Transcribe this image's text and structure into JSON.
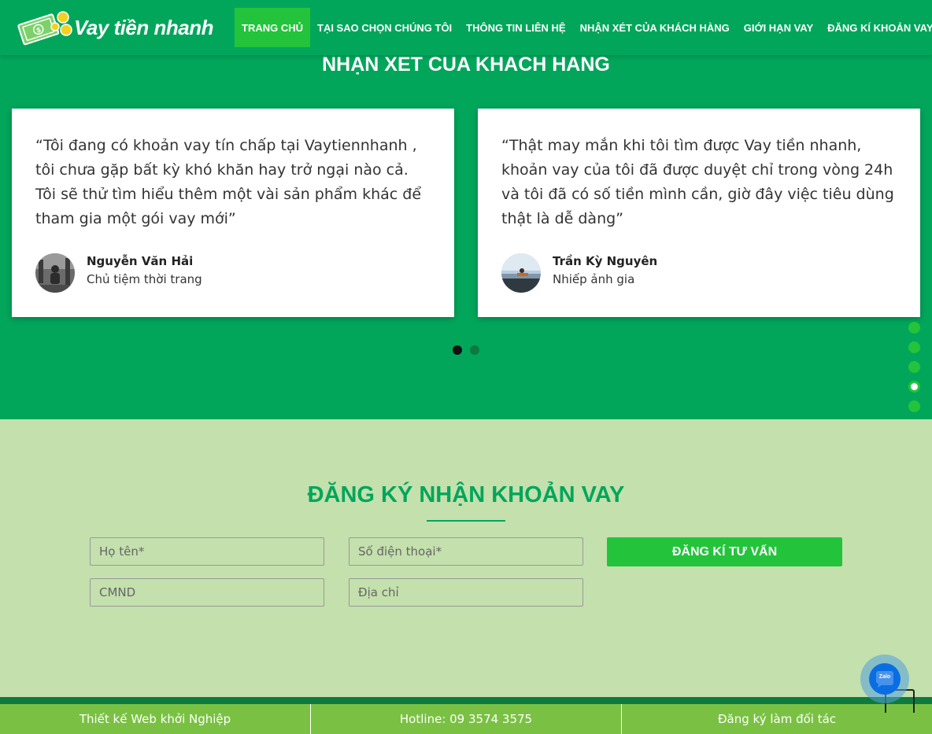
{
  "header": {
    "logo_text": "Vay tiền nhanh",
    "nav": [
      {
        "label": "TRANG CHỦ",
        "active": true
      },
      {
        "label": "TẠI SAO CHỌN CHÚNG TÔI"
      },
      {
        "label": "THÔNG TIN LIÊN HỆ"
      },
      {
        "label": "NHẬN XÉT CỦA KHÁCH HÀNG"
      },
      {
        "label": "GIỚI HẠN VAY"
      },
      {
        "label": "ĐĂNG KÍ KHOẢN VAY"
      }
    ]
  },
  "testimonials": {
    "title": "NHẠN XET CUA KHACH HANG",
    "items": [
      {
        "quote": "“Tôi đang có khoản vay tín chấp tại Vaytiennhanh , tôi chưa gặp bất kỳ khó khăn hay trở ngại nào cả. Tôi sẽ thử tìm hiểu thêm một vài sản phẩm khác để tham gia một gói vay mới”",
        "name": "Nguyễn Văn Hải",
        "role": "Chủ tiệm thời trang"
      },
      {
        "quote": "“Thật may mắn khi tôi tìm được Vay tiền nhanh, khoản vay của tôi đã được duyệt chỉ trong vòng 24h và tôi đã có số tiền mình cần, giờ đây việc tiêu dùng thật là dễ dàng”",
        "name": "Trần Kỳ Nguyên",
        "role": "Nhiếp ảnh gia"
      }
    ]
  },
  "register": {
    "title": "ĐĂNG KÝ NHẬN KHOẢN VAY",
    "name_placeholder": "Họ tên*",
    "phone_placeholder": "Số điện thoại*",
    "id_placeholder": "CMND",
    "address_placeholder": "Địa chỉ",
    "submit_label": "ĐĂNG KÍ TƯ VẤN"
  },
  "footer": {
    "left": "Thiết kế Web khởi Nghiệp",
    "middle": "Hotline: 09 3574 3575",
    "right": "Đăng ký làm đối tác"
  },
  "zalo": {
    "label": "Zalo"
  },
  "colors": {
    "primary": "#02a65b",
    "accent": "#23c43b",
    "light_bg": "#c4e0ad",
    "footer": "#7ac143"
  }
}
